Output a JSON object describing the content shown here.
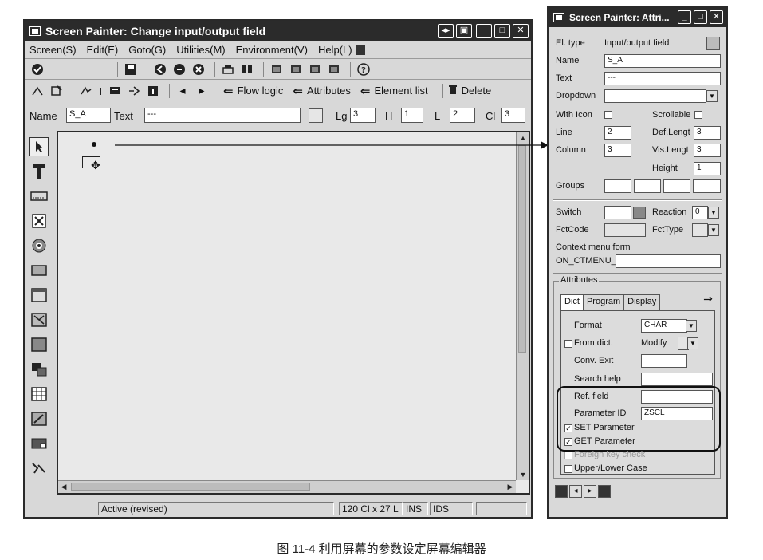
{
  "main": {
    "title": "Screen Painter:  Change input/output field",
    "menu": [
      "Screen(S)",
      "Edit(E)",
      "Goto(G)",
      "Utilities(M)",
      "Environment(V)",
      "Help(L)"
    ],
    "toolbar2": {
      "flow_logic": "Flow logic",
      "attributes": "Attributes",
      "element_list": "Element list",
      "delete": "Delete"
    },
    "namebar": {
      "name_label": "Name",
      "name_value": "S_A",
      "text_label": "Text",
      "text_value": "---",
      "lg_label": "Lg",
      "lg_value": "3",
      "h_label": "H",
      "h_value": "1",
      "l_label": "L",
      "l_value": "2",
      "cl_label": "Cl",
      "cl_value": "3"
    },
    "status": {
      "mode": "Active (revised)",
      "size": "120 Cl x 27 L",
      "ins": "INS",
      "ids": "IDS"
    }
  },
  "attr": {
    "title": "Screen Painter: Attri...",
    "el_type_label": "El. type",
    "el_type_value": "Input/output field",
    "name_label": "Name",
    "name_value": "S_A",
    "text_label": "Text",
    "text_value": "---",
    "dropdown_label": "Dropdown",
    "with_icon_label": "With Icon",
    "scrollable_label": "Scrollable",
    "line_label": "Line",
    "line_value": "2",
    "def_length_label": "Def.Lengt",
    "def_length_value": "3",
    "column_label": "Column",
    "column_value": "3",
    "vis_length_label": "Vis.Lengt",
    "vis_length_value": "3",
    "height_label": "Height",
    "height_value": "1",
    "groups_label": "Groups",
    "switch_label": "Switch",
    "reaction_label": "Reaction",
    "reaction_value": "0",
    "fctcode_label": "FctCode",
    "fcttype_label": "FctType",
    "context_menu_label": "Context menu form",
    "context_menu_value": "ON_CTMENU_",
    "attributes_group": "Attributes",
    "tabs": [
      "Dict",
      "Program",
      "Display"
    ],
    "format_label": "Format",
    "format_value": "CHAR",
    "from_dict_label": "From dict.",
    "modify_label": "Modify",
    "conv_exit_label": "Conv. Exit",
    "search_help_label": "Search help",
    "ref_field_label": "Ref. field",
    "parameter_id_label": "Parameter ID",
    "parameter_id_value": "ZSCL",
    "set_parameter_label": "SET Parameter",
    "get_parameter_label": "GET Parameter",
    "foreign_key_label": "Foreign key check",
    "upper_lower_label": "Upper/Lower Case"
  },
  "caption": "图 11-4   利用屏幕的参数设定屏幕编辑器",
  "colors": {
    "titlebar": "#2b2b2b",
    "window": "#d8d8d8",
    "canvas": "#e9e9e9"
  }
}
